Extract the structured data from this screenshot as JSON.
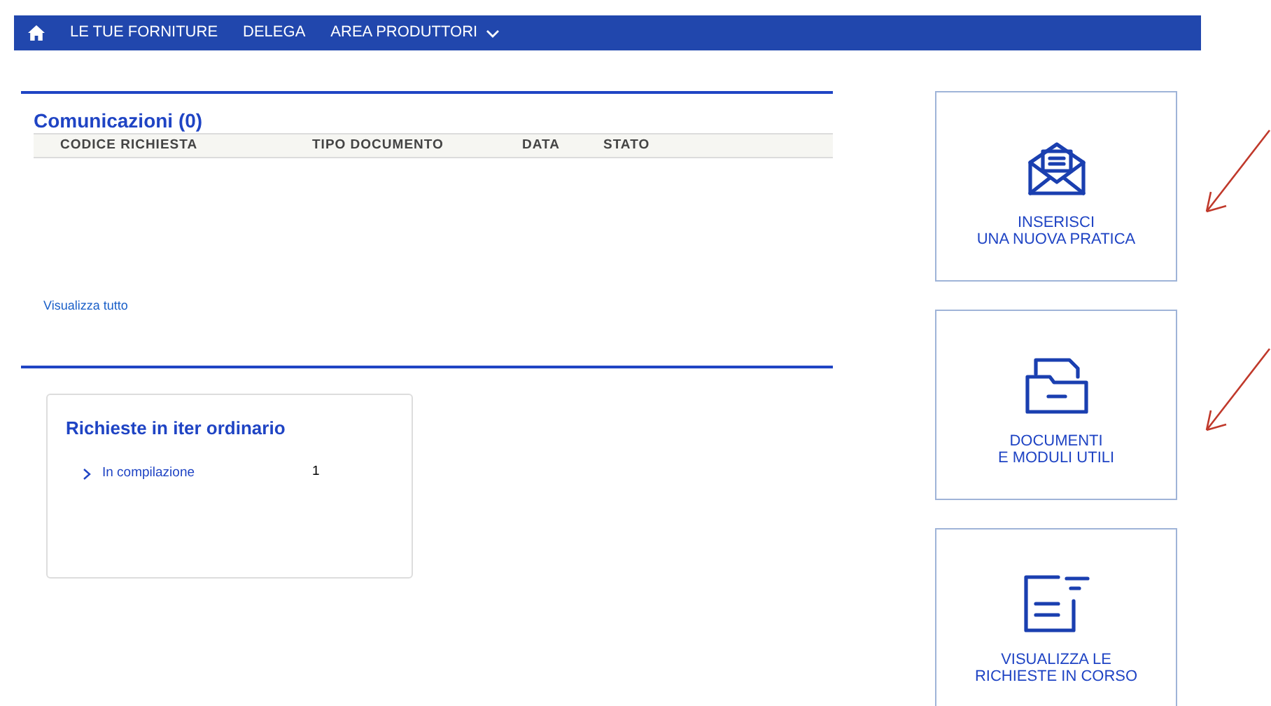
{
  "nav": {
    "items": [
      {
        "kind": "home"
      },
      {
        "kind": "link",
        "label": "LE TUE FORNITURE"
      },
      {
        "kind": "link",
        "label": "DELEGA"
      },
      {
        "kind": "dropdown",
        "label": "AREA PRODUTTORI"
      }
    ]
  },
  "communications": {
    "title": "Comunicazioni (0)",
    "columns": [
      "CODICE RICHIESTA",
      "TIPO DOCUMENTO",
      "DATA",
      "STATO"
    ],
    "view_all": "Visualizza tutto"
  },
  "requests_card": {
    "title": "Richieste in iter ordinario",
    "rows": [
      {
        "label": "In compilazione",
        "count": "1"
      }
    ]
  },
  "tiles": [
    {
      "kind": "envelope",
      "lines": [
        "INSERISCI",
        "UNA NUOVA PRATICA"
      ],
      "annotated": true
    },
    {
      "kind": "folder",
      "lines": [
        "DOCUMENTI",
        "E MODULI UTILI"
      ],
      "annotated": true
    },
    {
      "kind": "list",
      "lines": [
        "VISUALIZZA LE",
        "RICHIESTE IN CORSO"
      ],
      "annotated": false
    }
  ]
}
